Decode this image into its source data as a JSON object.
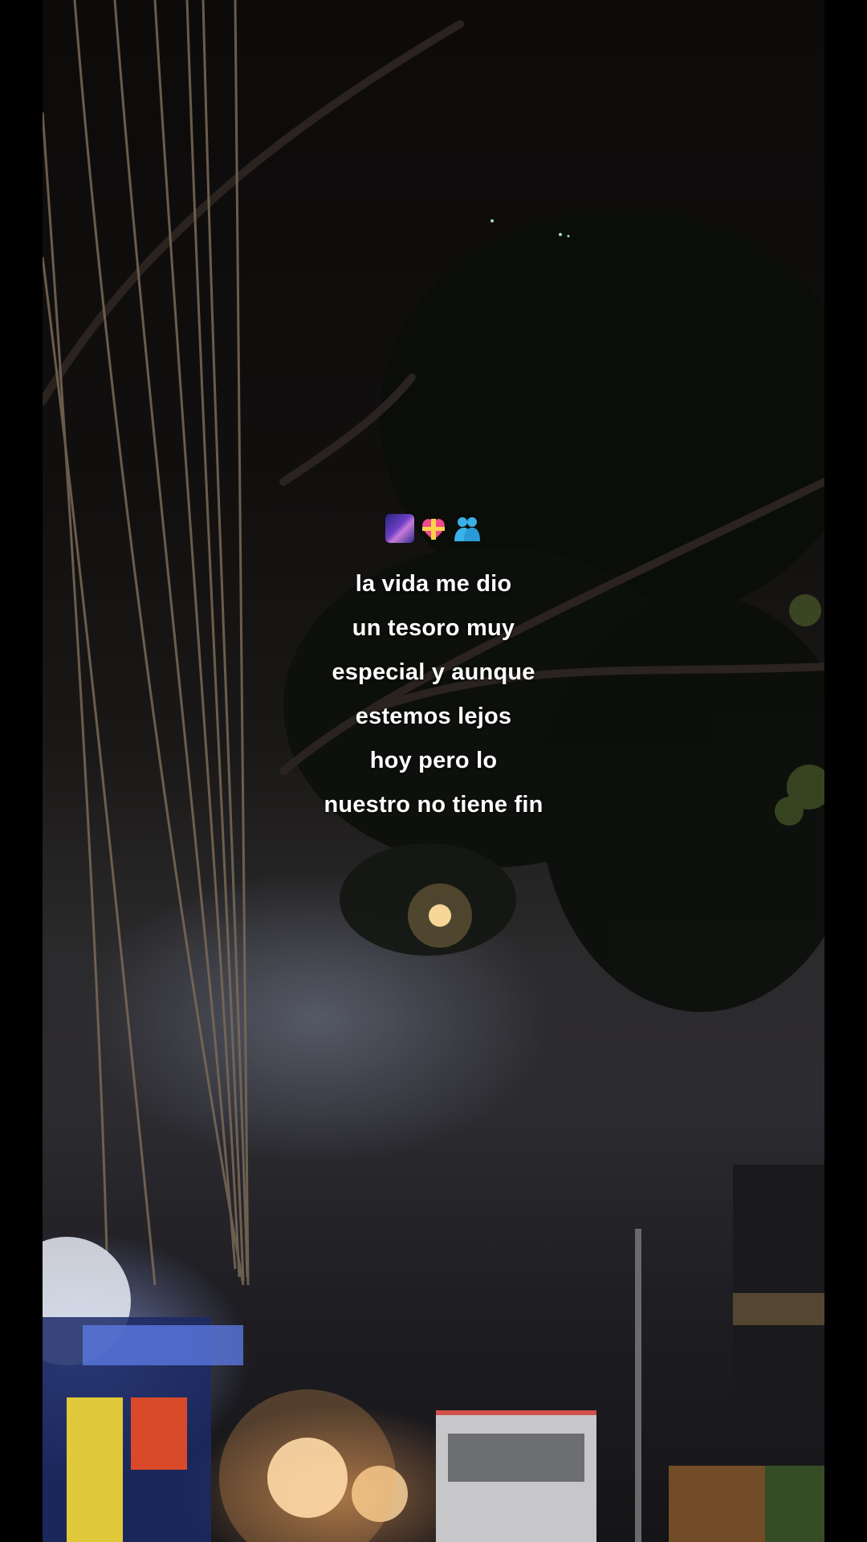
{
  "caption": {
    "icons": [
      "milky-way-icon",
      "heart-with-ribbon-icon",
      "people-hugging-icon"
    ],
    "lines": [
      "la vida me dio",
      "un tesoro muy",
      "especial y aunque",
      "estemos lejos",
      "hoy pero lo",
      "nuestro no tiene fin"
    ]
  },
  "colors": {
    "letterbox": "#000000",
    "caption_text": "#ffffff"
  }
}
